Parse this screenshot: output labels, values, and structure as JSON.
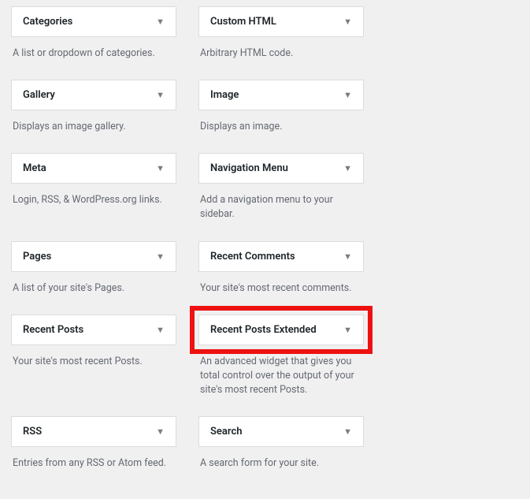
{
  "widgets": [
    [
      {
        "title": "Categories",
        "desc": "A list or dropdown of categories."
      },
      {
        "title": "Custom HTML",
        "desc": "Arbitrary HTML code."
      }
    ],
    [
      {
        "title": "Gallery",
        "desc": "Displays an image gallery."
      },
      {
        "title": "Image",
        "desc": "Displays an image."
      }
    ],
    [
      {
        "title": "Meta",
        "desc": "Login, RSS, & WordPress.org links."
      },
      {
        "title": "Navigation Menu",
        "desc": "Add a navigation menu to your sidebar."
      }
    ],
    [
      {
        "title": "Pages",
        "desc": "A list of your site's Pages."
      },
      {
        "title": "Recent Comments",
        "desc": "Your site's most recent comments."
      }
    ],
    [
      {
        "title": "Recent Posts",
        "desc": "Your site's most recent Posts."
      },
      {
        "title": "Recent Posts Extended",
        "desc": "An advanced widget that gives you total control over the output of your site's most recent Posts.",
        "highlighted": true
      }
    ],
    [
      {
        "title": "RSS",
        "desc": "Entries from any RSS or Atom feed."
      },
      {
        "title": "Search",
        "desc": "A search form for your site."
      }
    ]
  ]
}
